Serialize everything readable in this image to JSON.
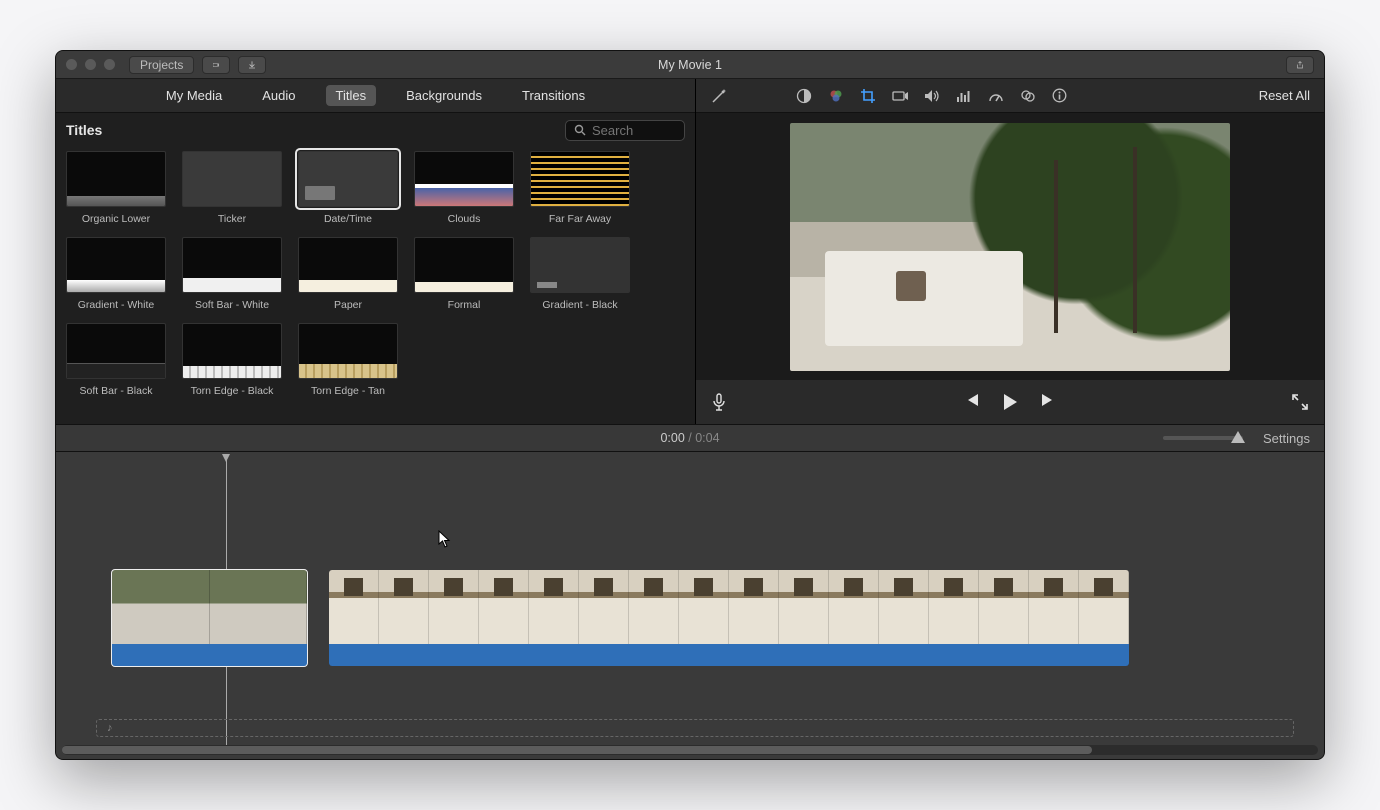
{
  "window": {
    "title": "My Movie 1"
  },
  "toolbar": {
    "projects": "Projects"
  },
  "tabs": {
    "items": [
      "My Media",
      "Audio",
      "Titles",
      "Backgrounds",
      "Transitions"
    ],
    "active": "Titles"
  },
  "browser": {
    "heading": "Titles",
    "search_placeholder": "Search",
    "tiles": [
      {
        "label": "Organic Lower",
        "style": "th-organic"
      },
      {
        "label": "Ticker",
        "style": "th-ticker"
      },
      {
        "label": "Date/Time",
        "style": "th-dt",
        "selected": true
      },
      {
        "label": "Clouds",
        "style": "th-clouds"
      },
      {
        "label": "Far Far Away",
        "style": "th-ffa"
      },
      {
        "label": "Gradient - White",
        "style": "th-gw"
      },
      {
        "label": "Soft Bar - White",
        "style": "th-sbw"
      },
      {
        "label": "Paper",
        "style": "th-paper"
      },
      {
        "label": "Formal",
        "style": "th-formal"
      },
      {
        "label": "Gradient - Black",
        "style": "th-gb"
      },
      {
        "label": "Soft Bar - Black",
        "style": "th-sbb"
      },
      {
        "label": "Torn Edge - Black",
        "style": "th-teb"
      },
      {
        "label": "Torn Edge - Tan",
        "style": "th-tet"
      }
    ]
  },
  "inspector": {
    "reset": "Reset All",
    "tools": [
      "enhance",
      "color-balance",
      "color-correct",
      "crop",
      "stabilize",
      "audio",
      "noise",
      "speed",
      "filters",
      "info"
    ]
  },
  "transport": {
    "current": "0:00",
    "sep": " / ",
    "duration": "0:04",
    "settings": "Settings"
  },
  "timeline": {
    "clips": [
      {
        "id": "clip-1",
        "frames": 2,
        "selected": true
      },
      {
        "id": "clip-2",
        "frames": 16
      }
    ],
    "soundtrack_icon": "♪"
  }
}
